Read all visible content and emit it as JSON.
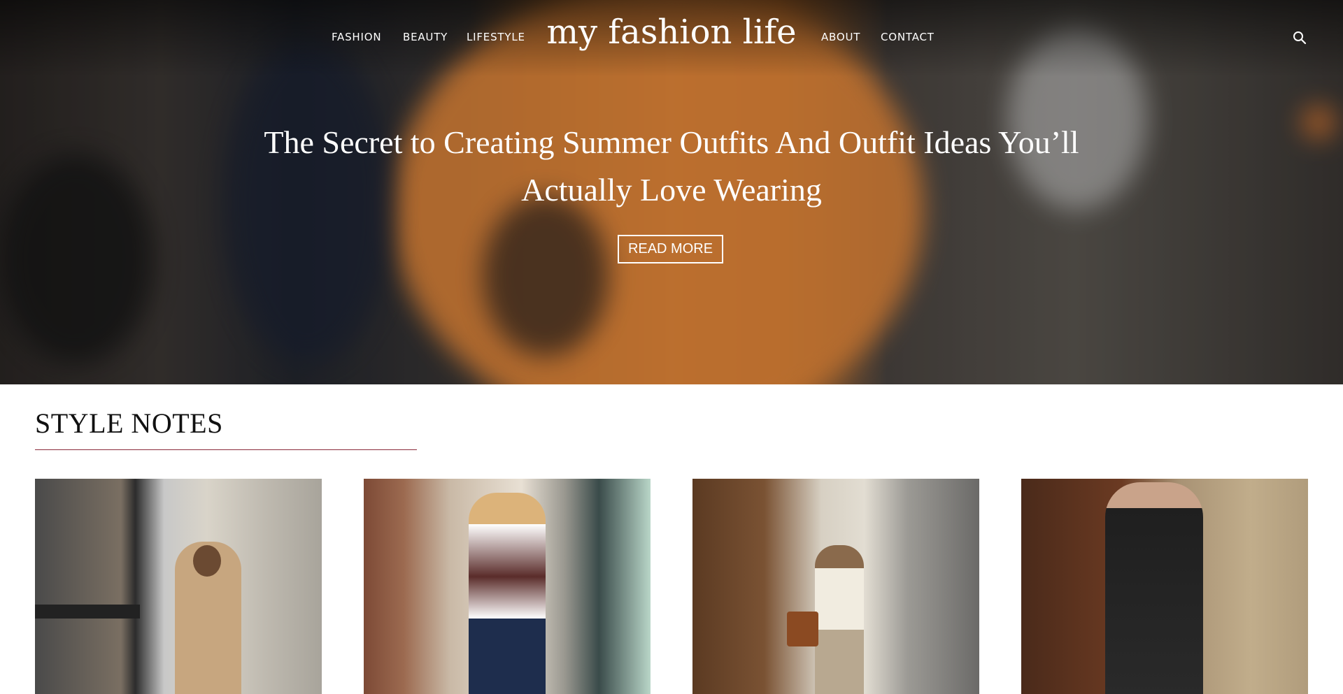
{
  "nav": {
    "left": [
      {
        "label": "FASHION"
      },
      {
        "label": "BEAUTY"
      },
      {
        "label": "LIFESTYLE"
      }
    ],
    "brand": "my fashion life",
    "right": [
      {
        "label": "ABOUT"
      },
      {
        "label": "CONTACT"
      }
    ],
    "search_icon": "search-icon"
  },
  "hero": {
    "title": "The Secret to Creating Summer Outfits And Outfit Ideas You’ll Actually Love Wearing",
    "button_label": "READ MORE"
  },
  "section": {
    "title": "STYLE NOTES",
    "rule_color": "#8a2a3a"
  },
  "cards": [
    {
      "image": "photo-woman-trench-coat-sitting"
    },
    {
      "image": "photo-woman-striped-sweater-jeans"
    },
    {
      "image": "photo-woman-white-vest-street"
    },
    {
      "image": "photo-woman-leather-jacket-door"
    }
  ]
}
